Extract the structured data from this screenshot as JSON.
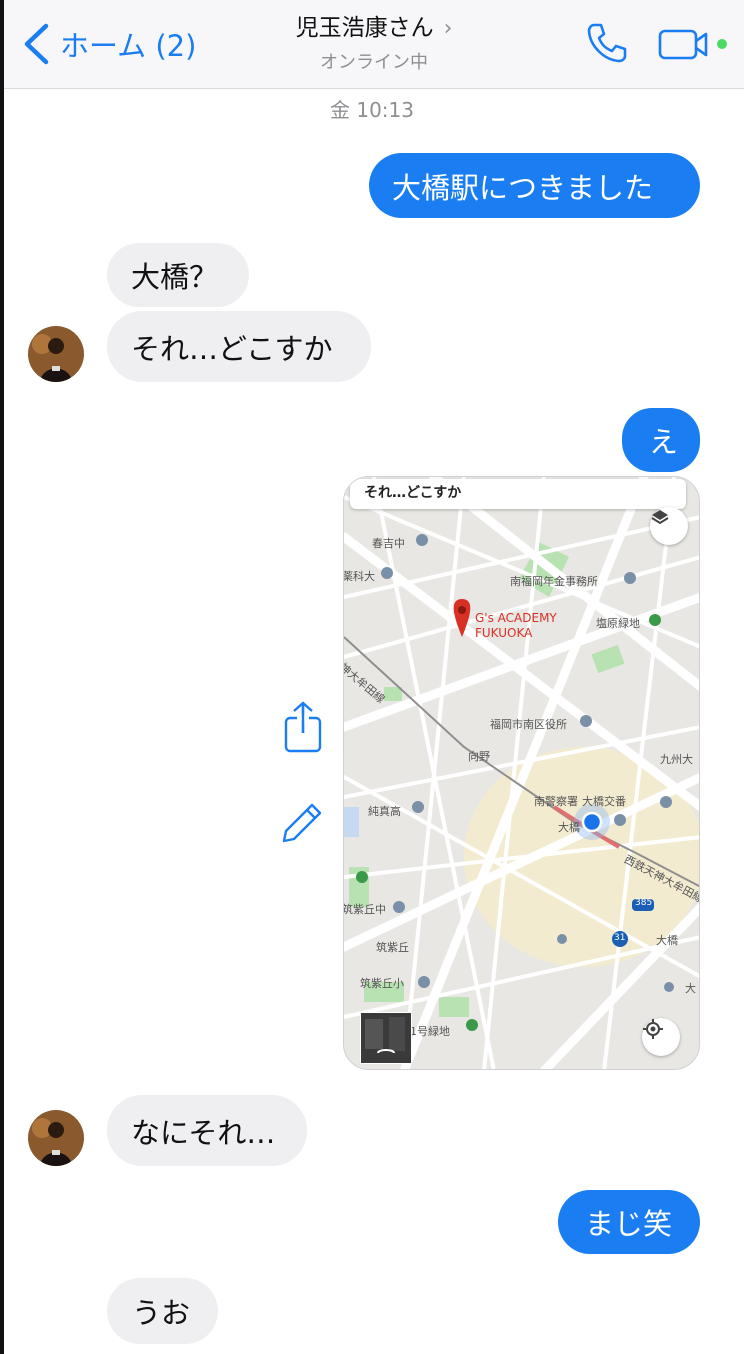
{
  "header": {
    "back_label": "ホーム (2)",
    "contact_name": "児玉浩康さん",
    "chevron": "›",
    "status": "オンライン中",
    "call_icon": "phone-icon",
    "video_icon": "video-camera-icon",
    "accent_color": "#1a7ef2",
    "online_color": "#4cd964"
  },
  "thread": {
    "timestamp": "金 10:13",
    "messages": [
      {
        "from": "me",
        "text": "大橋駅につきました"
      },
      {
        "from": "them",
        "text": "大橋？"
      },
      {
        "from": "them",
        "text": "それ…どこすか"
      },
      {
        "from": "me",
        "text": "え"
      },
      {
        "from": "me",
        "type": "map-screenshot"
      },
      {
        "from": "them",
        "text": "なにそれ…"
      },
      {
        "from": "me",
        "text": "まじ笑"
      },
      {
        "from": "them",
        "text": "うお"
      }
    ]
  },
  "map": {
    "search_text": "それ…どこすか",
    "pin_label_1": "G's ACADEMY",
    "pin_label_2": "FUKUOKA",
    "labels": {
      "harukichi": "春吉中",
      "kaka": "薬科大",
      "nenkin": "南福岡年金事務所",
      "shiobaru": "塩原緑地",
      "tenjin_line": "天神大牟田線",
      "kuyakusho": "福岡市南区役所",
      "muko": "向野",
      "kyushu": "九州大",
      "keisatsu": "南警察署",
      "koban": "大橋交番",
      "ohashi_station": "大橋",
      "junko": "純真高",
      "tenjin_line_2": "西鉄天神大牟田線",
      "chikushigaoka_chu": "筑紫丘中",
      "route385": "385",
      "chikushigaoka": "筑紫丘",
      "route31": "31",
      "ohashi": "大橋",
      "chikushigaoka_sho": "筑紫丘小",
      "ryokuchi": "1号緑地",
      "right_edge": "大"
    }
  }
}
